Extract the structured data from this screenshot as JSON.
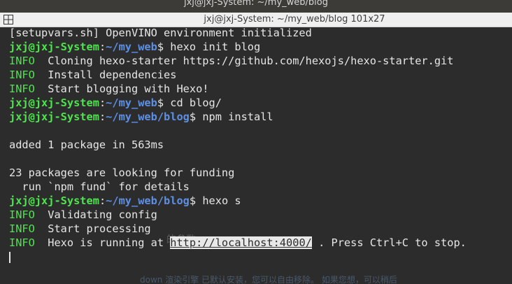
{
  "background_window": {
    "title": "jxj@jxj-System: ~/my_web/blog",
    "partial_text_mid": "的参数。",
    "partial_text_bottom": "down 渲染引擎 已默认安装，您可以自由移除。 如果您想，可以稍后"
  },
  "window": {
    "title": "jxj@jxj-System: ~/my_web/blog 101x27"
  },
  "terminal": {
    "lines": [
      {
        "type": "text",
        "text": "[setupvars.sh] OpenVINO environment initialized"
      },
      {
        "type": "prompt",
        "user": "jxj@jxj-System",
        "sep": ":",
        "path": "~/my_web",
        "symbol": "$ ",
        "cmd": "hexo init blog"
      },
      {
        "type": "info",
        "tag": "INFO",
        "text": "  Cloning hexo-starter https://github.com/hexojs/hexo-starter.git"
      },
      {
        "type": "info",
        "tag": "INFO",
        "text": "  Install dependencies"
      },
      {
        "type": "info",
        "tag": "INFO",
        "text": "  Start blogging with Hexo!"
      },
      {
        "type": "prompt",
        "user": "jxj@jxj-System",
        "sep": ":",
        "path": "~/my_web",
        "symbol": "$ ",
        "cmd": "cd blog/"
      },
      {
        "type": "prompt",
        "user": "jxj@jxj-System",
        "sep": ":",
        "path": "~/my_web/blog",
        "symbol": "$ ",
        "cmd": "npm install"
      },
      {
        "type": "text",
        "text": ""
      },
      {
        "type": "text",
        "text": "added 1 package in 563ms"
      },
      {
        "type": "text",
        "text": ""
      },
      {
        "type": "text",
        "text": "23 packages are looking for funding"
      },
      {
        "type": "text",
        "text": "  run `npm fund` for details"
      },
      {
        "type": "prompt",
        "user": "jxj@jxj-System",
        "sep": ":",
        "path": "~/my_web/blog",
        "symbol": "$ ",
        "cmd": "hexo s"
      },
      {
        "type": "info",
        "tag": "INFO",
        "text": "  Validating config"
      },
      {
        "type": "info",
        "tag": "INFO",
        "text": "  Start processing"
      },
      {
        "type": "info-url",
        "tag": "INFO",
        "pre": "  Hexo is running at ",
        "url": "http://localhost:4000/",
        "post": " . Press Ctrl+C to stop."
      },
      {
        "type": "cursor"
      }
    ]
  },
  "colors": {
    "user": "#4ee44e",
    "path": "#5d8fe3",
    "info": "#4ee44e",
    "text": "#e6e6e6",
    "background": "#2c2c2c"
  },
  "icons": {
    "tab_button": "new-tab-icon"
  }
}
